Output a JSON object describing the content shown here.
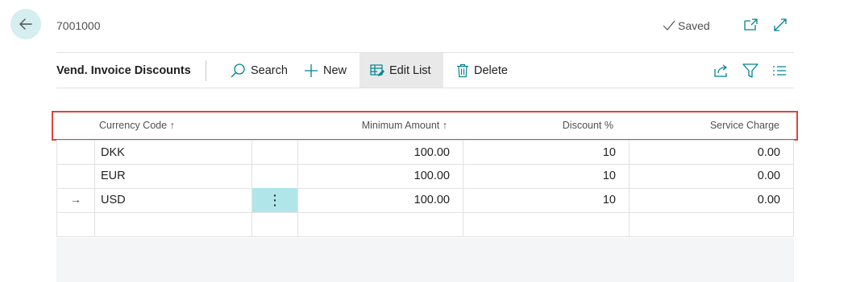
{
  "header": {
    "record_id": "7001000",
    "saved_label": "Saved"
  },
  "toolbar": {
    "page_name": "Vend. Invoice Discounts",
    "search_label": "Search",
    "new_label": "New",
    "edit_list_label": "Edit List",
    "delete_label": "Delete"
  },
  "table": {
    "columns": {
      "currency_code": "Currency Code",
      "minimum_amount": "Minimum Amount",
      "discount_pct": "Discount %",
      "service_charge": "Service Charge"
    },
    "sort_indicator": "↑",
    "rows": [
      {
        "indicator": "",
        "currency_code": "DKK",
        "minimum_amount": "100.00",
        "discount_pct": "10",
        "service_charge": "0.00"
      },
      {
        "indicator": "",
        "currency_code": "EUR",
        "minimum_amount": "100.00",
        "discount_pct": "10",
        "service_charge": "0.00"
      },
      {
        "indicator": "→",
        "currency_code": "USD",
        "menu": "⋮",
        "minimum_amount": "100.00",
        "discount_pct": "10",
        "service_charge": "0.00"
      }
    ]
  },
  "colors": {
    "accent": "#00838f",
    "highlight_border": "#d9463e",
    "back_button_bg": "#d5eef0",
    "selected_cell_bg": "#b0e6ea"
  }
}
